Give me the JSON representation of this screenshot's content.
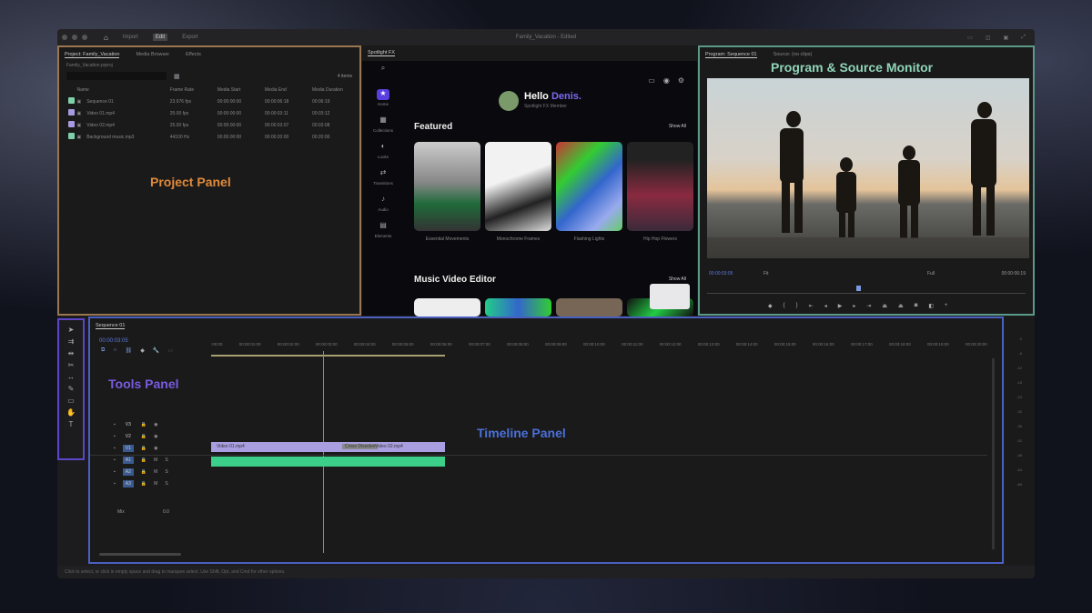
{
  "window": {
    "title": "Family_Vacation - Edited",
    "nav": [
      "Import",
      "Edit",
      "Export"
    ]
  },
  "project": {
    "tabs": [
      "Project: Family_Vacation",
      "Media Browser",
      "Effects"
    ],
    "path": "Family_Vacation.prproj",
    "items_count": "4 items",
    "columns": [
      "Name",
      "Frame Rate",
      "Media Start",
      "Media End",
      "Media Duration"
    ],
    "rows": [
      {
        "name": "Sequence 01",
        "rate": "23.976 fps",
        "start": "00:00:00:00",
        "end": "00:00:06:18",
        "dur": "00:06:19",
        "color": "#7fd0a8"
      },
      {
        "name": "Video 01.mp4",
        "rate": "25.00 fps",
        "start": "00:00:00:00",
        "end": "00:00:03:11",
        "dur": "00:03:12",
        "color": "#a89ae0"
      },
      {
        "name": "Video 02.mp4",
        "rate": "25.00 fps",
        "start": "00:00:00:00",
        "end": "00:00:03:07",
        "dur": "00:03:08",
        "color": "#a89ae0"
      },
      {
        "name": "Background music.mp3",
        "rate": "44100 Hz",
        "start": "00:00:00:00",
        "end": "00:00:20:00",
        "dur": "00:20:00",
        "color": "#7fd0a8"
      }
    ]
  },
  "spotlight": {
    "tab": "Spotlight FX",
    "greeting": "Hello",
    "user": "Denis.",
    "subtitle": "Spotlight FX Member",
    "featured": "Featured",
    "show_all": "Show All",
    "music_section": "Music Video Editor",
    "sidebar": [
      "Home",
      "Collections",
      "Looks",
      "Transitions",
      "Audio",
      "Elements"
    ],
    "cards": [
      "Essential Movements",
      "Monochrome Frames",
      "Flashing Lights",
      "Hip Hop Flowers"
    ]
  },
  "monitor": {
    "tabs": [
      "Program: Sequence 01",
      "Source: (no clips)"
    ],
    "timecode": "00:00:03:05",
    "fit": "Fit",
    "quality": "Full",
    "duration": "00:00:06:19"
  },
  "timeline": {
    "tab": "Sequence 01",
    "timecode": "00:00:03:05",
    "ruler": [
      ":00:00",
      "00:00:01:00",
      "00:00:02:00",
      "00:00:03:00",
      "00:00:04:00",
      "00:00:05:00",
      "00:00:06:00",
      "00:00:07:00",
      "00:00:08:00",
      "00:00:09:00",
      "00:00:10:00",
      "00:00:11:00",
      "00:00:12:00",
      "00:00:13:00",
      "00:00:14:00",
      "00:00:15:00",
      "00:00:16:00",
      "00:00:17:00",
      "00:00:18:00",
      "00:00:19:00",
      "00:00:20:00"
    ],
    "tracks": [
      "V3",
      "V2",
      "V1",
      "A1",
      "A2",
      "A3"
    ],
    "clips": [
      "Video 01.mp4",
      "Cross Dissolve",
      "Video 02.mp4"
    ],
    "mix": "Mix",
    "mix_value": "0.0"
  },
  "meter_labels": [
    "0",
    "-6",
    "-12",
    "-18",
    "-24",
    "-30",
    "-36",
    "-42",
    "-48",
    "-54",
    "dB"
  ],
  "status": "Click to select, or click in empty space and drag to marquee select. Use Shift, Opt, and Cmd for other options.",
  "annotations": {
    "project": "Project Panel",
    "monitor": "Program & Source Monitor",
    "tools": "Tools Panel",
    "timeline": "Timeline Panel"
  },
  "colors": {
    "project": "#e08a3a",
    "monitor": "#7fc9a8",
    "tools": "#6a4fd0",
    "timeline": "#4a6fd0",
    "accent": "#5a3ee0"
  }
}
